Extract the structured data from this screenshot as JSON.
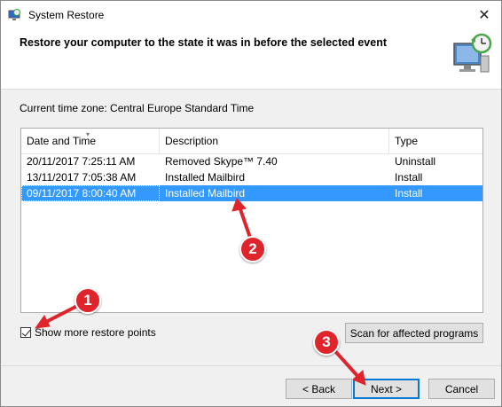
{
  "window": {
    "title": "System Restore",
    "close_glyph": "✕",
    "icon": "system-restore-icon"
  },
  "header": {
    "heading": "Restore your computer to the state it was in before the selected event",
    "icon": "monitor-clock-icon"
  },
  "timezone_text": "Current time zone: Central Europe Standard Time",
  "list": {
    "columns": [
      "Date and Time",
      "Description",
      "Type"
    ],
    "sort_indicator": "▾",
    "rows": [
      {
        "date": "20/11/2017 7:25:11 AM",
        "description": "Removed Skype™ 7.40",
        "type": "Uninstall",
        "selected": false
      },
      {
        "date": "13/11/2017 7:05:38 AM",
        "description": "Installed Mailbird",
        "type": "Install",
        "selected": false
      },
      {
        "date": "09/11/2017 8:00:40 AM",
        "description": "Installed Mailbird",
        "type": "Install",
        "selected": true
      }
    ]
  },
  "show_more": {
    "label": "Show more restore points",
    "checked": true
  },
  "buttons": {
    "scan": "Scan for affected programs",
    "back": "< Back",
    "next": "Next >",
    "cancel": "Cancel"
  },
  "annotations": {
    "badge1": "1",
    "badge2": "2",
    "badge3": "3",
    "color": "#e0242c"
  },
  "colors": {
    "selection": "#3399ff",
    "default_button_border": "#0078d7"
  }
}
